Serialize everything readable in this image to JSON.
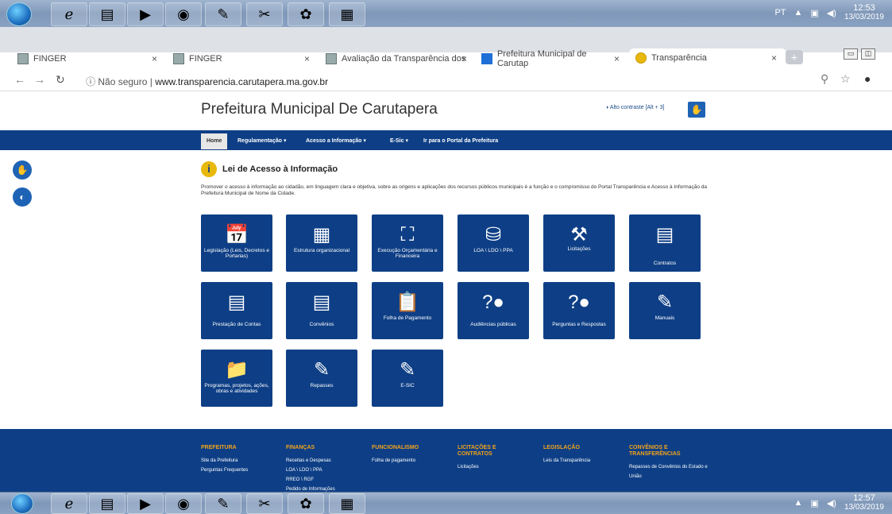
{
  "os": {
    "lang": "PT",
    "time_top": "12:53",
    "date_top": "13/03/2019",
    "time_bottom": "12:57",
    "date_bottom": "13/03/2019"
  },
  "browser": {
    "tabs": [
      {
        "label": "FINGER"
      },
      {
        "label": "FINGER"
      },
      {
        "label": "Avaliação da Transparência dos"
      },
      {
        "label": "Prefeitura Municipal de Carutap"
      },
      {
        "label": "Transparência"
      }
    ],
    "security": "Não seguro",
    "url": "www.transparencia.carutapera.ma.gov.br"
  },
  "site": {
    "title": "Prefeitura Municipal De Carutapera",
    "contrast": "Alto contraste [Alt + 3]",
    "nav": [
      "Home",
      "Regulamentação ▾",
      "Acesso a Informação ▾",
      "E-Sic ▾",
      "Ir para o Portal da Prefeitura"
    ],
    "heading": "Lei de Acesso à Informação",
    "description": "Promover o acesso à informação ao cidadão, em linguagem clara e objetiva, sobre as origens e aplicações dos recursos públicos municipais é a função e o compromisso do Portal Transparência e Acesso à Informação da Prefeitura Municipal de Nome da Cidade.",
    "tiles": [
      {
        "label": "Legislação (Leis, Decretos e Portarias)",
        "icon": "calendar-icon"
      },
      {
        "label": "Estrutura organizacional",
        "icon": "building-icon"
      },
      {
        "label": "Execução Orçamentária e Financeira",
        "icon": "presentation-icon"
      },
      {
        "label": "LOA \\ LDO \\ PPA",
        "icon": "coins-icon"
      },
      {
        "label": "Licitações",
        "icon": "gavel-icon"
      },
      {
        "label": "Contratos",
        "icon": "document-icon"
      },
      {
        "label": "Prestação de Contas",
        "icon": "document-icon"
      },
      {
        "label": "Convênios",
        "icon": "document-icon"
      },
      {
        "label": "Folha de Pagamento",
        "icon": "clipboard-icon"
      },
      {
        "label": "Audiências públicas",
        "icon": "question-person-icon"
      },
      {
        "label": "Perguntas e Respostas",
        "icon": "question-person-icon"
      },
      {
        "label": "Manuais",
        "icon": "edit-icon"
      },
      {
        "label": "Programas, projetos, ações, obras e atividades",
        "icon": "folder-icon"
      },
      {
        "label": "Repasses",
        "icon": "edit-icon"
      },
      {
        "label": "E-SIC",
        "icon": "edit-icon"
      }
    ]
  },
  "footer": {
    "columns": [
      {
        "title": "PREFEITURA",
        "links": [
          "Site da Prefeitura",
          "Perguntas Frequentes"
        ]
      },
      {
        "title": "FINANÇAS",
        "links": [
          "Receitas e Despesas",
          "LOA \\ LDO \\ PPA",
          "RREO \\ RGF",
          "Pedido de Informações"
        ]
      },
      {
        "title": "FUNCIONALISMO",
        "links": [
          "Folha de pagamento"
        ]
      },
      {
        "title": "LICITAÇÕES E CONTRATOS",
        "links": [
          "Licitações"
        ]
      },
      {
        "title": "LEGISLAÇÃO",
        "links": [
          "Leis da Transparência"
        ]
      },
      {
        "title": "CONVÊNIOS E TRANSFERÊNCIAS",
        "links": [
          "Repasses de Convênios do Estado e União"
        ]
      }
    ]
  }
}
